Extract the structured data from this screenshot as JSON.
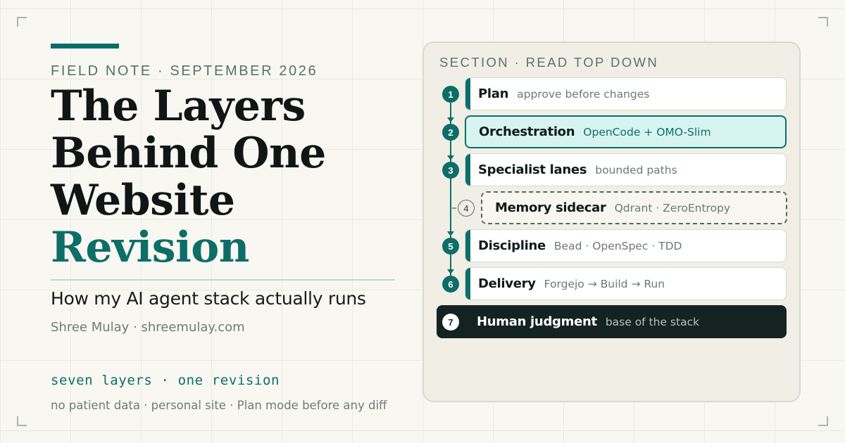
{
  "header": {
    "eyebrow": "FIELD NOTE · SEPTEMBER 2026",
    "title_lines": [
      "The Layers",
      "Behind One",
      "Website"
    ],
    "title_accent": "Revision",
    "subtitle": "How my AI agent stack actually runs",
    "byline": "Shree Mulay · shreemulay.com"
  },
  "footer": {
    "tagline": "seven layers · one revision",
    "note": "no patient data · personal site · Plan mode before any diff"
  },
  "panel": {
    "label": "SECTION · READ TOP DOWN",
    "layers": [
      {
        "num": "1",
        "name": "Plan",
        "desc": "approve before changes",
        "style": "default"
      },
      {
        "num": "2",
        "name": "Orchestration",
        "desc": "OpenCode + OMO-Slim",
        "style": "highlight"
      },
      {
        "num": "3",
        "name": "Specialist lanes",
        "desc": "bounded paths",
        "style": "default"
      },
      {
        "num": "4",
        "name": "Memory sidecar",
        "desc": "Qdrant · ZeroEntropy",
        "style": "dashed"
      },
      {
        "num": "5",
        "name": "Discipline",
        "desc": "Bead · OpenSpec · TDD",
        "style": "default"
      },
      {
        "num": "6",
        "name": "Delivery",
        "desc": "Forgejo → Build → Run",
        "style": "default"
      },
      {
        "num": "7",
        "name": "Human judgment",
        "desc": "base of the stack",
        "style": "dark"
      }
    ]
  },
  "colors": {
    "accent": "#0d6e69",
    "background": "#f9f7f1",
    "panel": "#f1efe5",
    "highlight_fill": "#d7f4f1",
    "dark_fill": "#152222"
  }
}
